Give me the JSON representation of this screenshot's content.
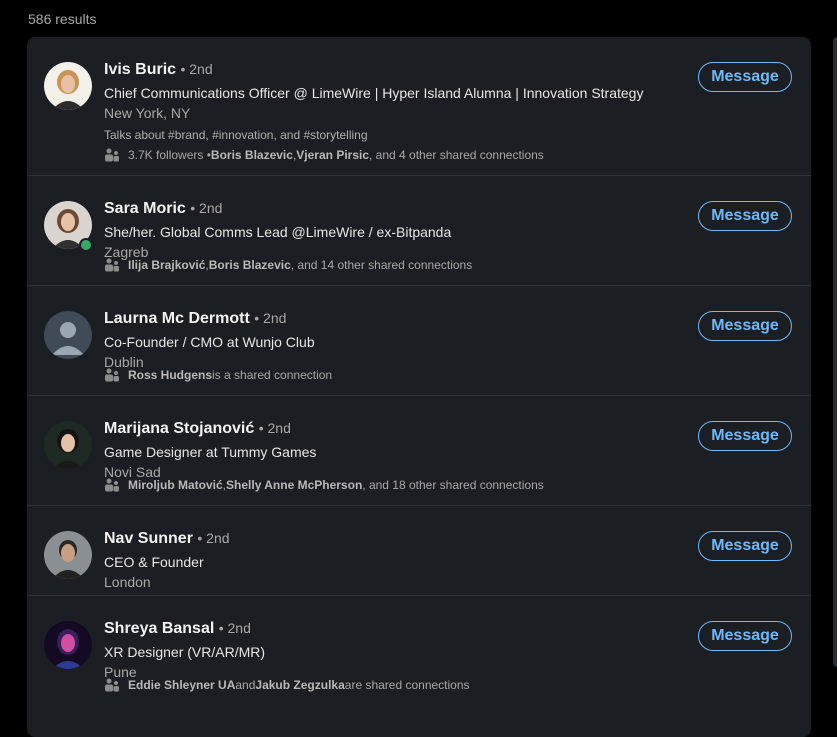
{
  "results_count": "586 results",
  "people": [
    {
      "name": "Ivis Buric",
      "degree": "• 2nd",
      "headline": "Chief Communications Officer @ LimeWire | Hyper Island Alumna | Innovation Strategy",
      "location": "New York, NY",
      "talks": "Talks about #brand, #innovation, and #storytelling",
      "shared_pre": "3.7K followers • ",
      "shared_bold1": "Boris Blazevic",
      "shared_mid": ", ",
      "shared_bold2": "Vjeran Pirsic",
      "shared_post": ", and 4 other shared connections",
      "button": "Message"
    },
    {
      "name": "Sara Moric",
      "degree": "• 2nd",
      "headline": "She/her. Global Comms Lead @LimeWire / ex-Bitpanda",
      "location": "Zagreb",
      "shared_bold1": "Ilija Brajković",
      "shared_mid": ", ",
      "shared_bold2": "Boris Blazevic",
      "shared_post": ", and 14 other shared connections",
      "button": "Message"
    },
    {
      "name": "Laurna Mc Dermott",
      "degree": "• 2nd",
      "headline": "Co-Founder / CMO at Wunjo Club",
      "location": "Dublin",
      "shared_bold1": "Ross Hudgens",
      "shared_post": " is a shared connection",
      "button": "Message"
    },
    {
      "name": "Marijana Stojanović",
      "degree": "• 2nd",
      "headline": "Game Designer at Tummy Games",
      "location": "Novi Sad",
      "shared_bold1": "Miroljub Matović",
      "shared_mid": ", ",
      "shared_bold2": "Shelly Anne McPherson",
      "shared_post": ", and 18 other shared connections",
      "button": "Message"
    },
    {
      "name": "Nav Sunner",
      "degree": "• 2nd",
      "headline": "CEO & Founder",
      "location": "London",
      "button": "Message"
    },
    {
      "name": "Shreya Bansal",
      "degree": "• 2nd",
      "headline": "XR Designer (VR/AR/MR)",
      "location": "Pune",
      "shared_bold1": "Eddie Shleyner UA",
      "shared_mid": " and ",
      "shared_bold2": "Jakub Zegzulka",
      "shared_post": " are shared connections",
      "button": "Message"
    }
  ]
}
